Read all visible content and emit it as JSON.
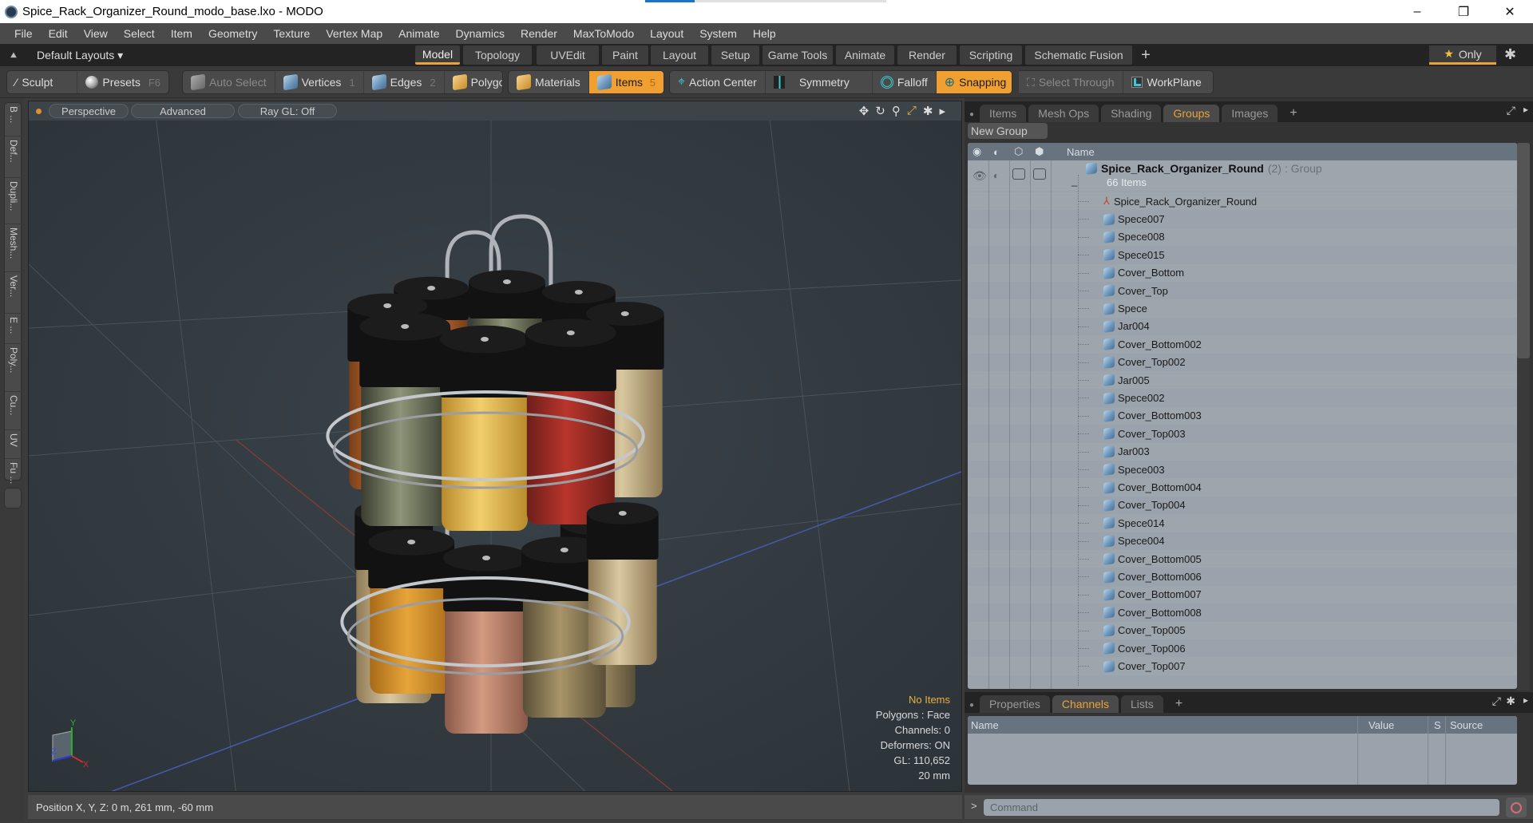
{
  "window": {
    "title": "Spice_Rack_Organizer_Round_modo_base.lxo - MODO",
    "controls": {
      "minimize": "–",
      "restore": "❐",
      "close": "✕"
    }
  },
  "menubar": [
    "File",
    "Edit",
    "View",
    "Select",
    "Item",
    "Geometry",
    "Texture",
    "Vertex Map",
    "Animate",
    "Dynamics",
    "Render",
    "MaxToModo",
    "Layout",
    "System",
    "Help"
  ],
  "layoutbar": {
    "layouts_label": "Default Layouts ▾",
    "tabs": [
      "Model",
      "Topology",
      "UVEdit",
      "Paint",
      "Layout",
      "Setup",
      "Game Tools",
      "Animate",
      "Render",
      "Scripting",
      "Schematic Fusion"
    ],
    "active_tab": "Model",
    "add": "+",
    "only_label": "Only"
  },
  "toolbar": {
    "sculpt": "Sculpt",
    "presets": "Presets",
    "presets_hotkey": "F6",
    "auto_select": "Auto Select",
    "vertices": "Vertices",
    "vertices_count": "1",
    "edges": "Edges",
    "edges_count": "2",
    "polygons": "Polygons",
    "materials": "Materials",
    "items": "Items",
    "items_count": "5",
    "action_center": "Action Center",
    "symmetry": "Symmetry",
    "falloff": "Falloff",
    "snapping": "Snapping",
    "select_through": "Select Through",
    "workplane": "WorkPlane"
  },
  "left_strip": [
    "B ...",
    "Def...",
    "Dupli...",
    "Mesh...",
    "Ver...",
    "E ...",
    "Poly...",
    "Cu...",
    "UV",
    "Fu ..."
  ],
  "viewport": {
    "view_mode": "Perspective",
    "shading": "Advanced",
    "raygl": "Ray GL: Off",
    "info": {
      "selection": "No Items",
      "polygons": "Polygons : Face",
      "channels": "Channels: 0",
      "deformers": "Deformers: ON",
      "gl": "GL: 110,652",
      "grid": "20 mm"
    },
    "axes": {
      "x": "X",
      "y": "Y",
      "z": "Z"
    }
  },
  "statusbar": {
    "position": "Position X, Y, Z:   0 m, 261 mm, -60 mm"
  },
  "groups_panel": {
    "tabs": [
      "Items",
      "Mesh Ops",
      "Shading",
      "Groups",
      "Images"
    ],
    "active_tab": "Groups",
    "new_group": "New Group",
    "column_name": "Name",
    "group": {
      "name": "Spice_Rack_Organizer_Round",
      "count": "(2)",
      "type": ": Group",
      "items": "66 Items"
    },
    "items": [
      "Spice_Rack_Organizer_Round",
      "Spece007",
      "Spece008",
      "Spece015",
      "Cover_Bottom",
      "Cover_Top",
      "Spece",
      "Jar004",
      "Cover_Bottom002",
      "Cover_Top002",
      "Jar005",
      "Spece002",
      "Cover_Bottom003",
      "Cover_Top003",
      "Jar003",
      "Spece003",
      "Cover_Bottom004",
      "Cover_Top004",
      "Spece014",
      "Spece004",
      "Cover_Bottom005",
      "Cover_Bottom006",
      "Cover_Bottom007",
      "Cover_Bottom008",
      "Cover_Top005",
      "Cover_Top006",
      "Cover_Top007"
    ]
  },
  "channels_panel": {
    "tabs": [
      "Properties",
      "Channels",
      "Lists"
    ],
    "active_tab": "Channels",
    "columns": [
      "Name",
      "Value",
      "S",
      "Source"
    ]
  },
  "command": {
    "placeholder": "Command",
    "prompt": ">"
  }
}
